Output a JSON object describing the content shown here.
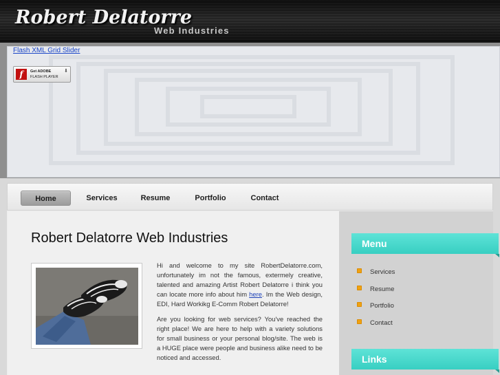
{
  "header": {
    "logo": "Robert Delatorre",
    "tagline": "Web Industries"
  },
  "flash": {
    "link_text": "Flash XML Grid Slider",
    "badge_line1": "Get ADOBE",
    "badge_line2": "FLASH PLAYER",
    "badge_icon": "f"
  },
  "nav": {
    "items": [
      {
        "label": "Home",
        "active": true
      },
      {
        "label": "Services"
      },
      {
        "label": "Resume"
      },
      {
        "label": "Portfolio"
      },
      {
        "label": "Contact"
      }
    ]
  },
  "main": {
    "title": "Robert Delatorre Web Industries",
    "p1_before_link": "Hi and welcome to my site RobertDelatorre.com, unfortunately im not the famous, extermely creative, talented and amazing Artist Robert Delatorre i think you can locate more info about him ",
    "p1_link": "here",
    "p1_after_link": ". Im the Web design, EDI, Hard Workikg E-Comm Robert Delatorre!",
    "p2": "Are you looking for web services? You've reached the right place! We are here to help with a variety solutions for small business or your personal blog/site. The web is a HUGE place were people and business alike need to be noticed and accessed."
  },
  "sidebar": {
    "menu_title": "Menu",
    "menu_items": [
      "Services",
      "Resume",
      "Portfolio",
      "Contact"
    ],
    "links_title": "Links",
    "accent_color": "#44d8cb",
    "bullet_color": "#f0a211"
  }
}
